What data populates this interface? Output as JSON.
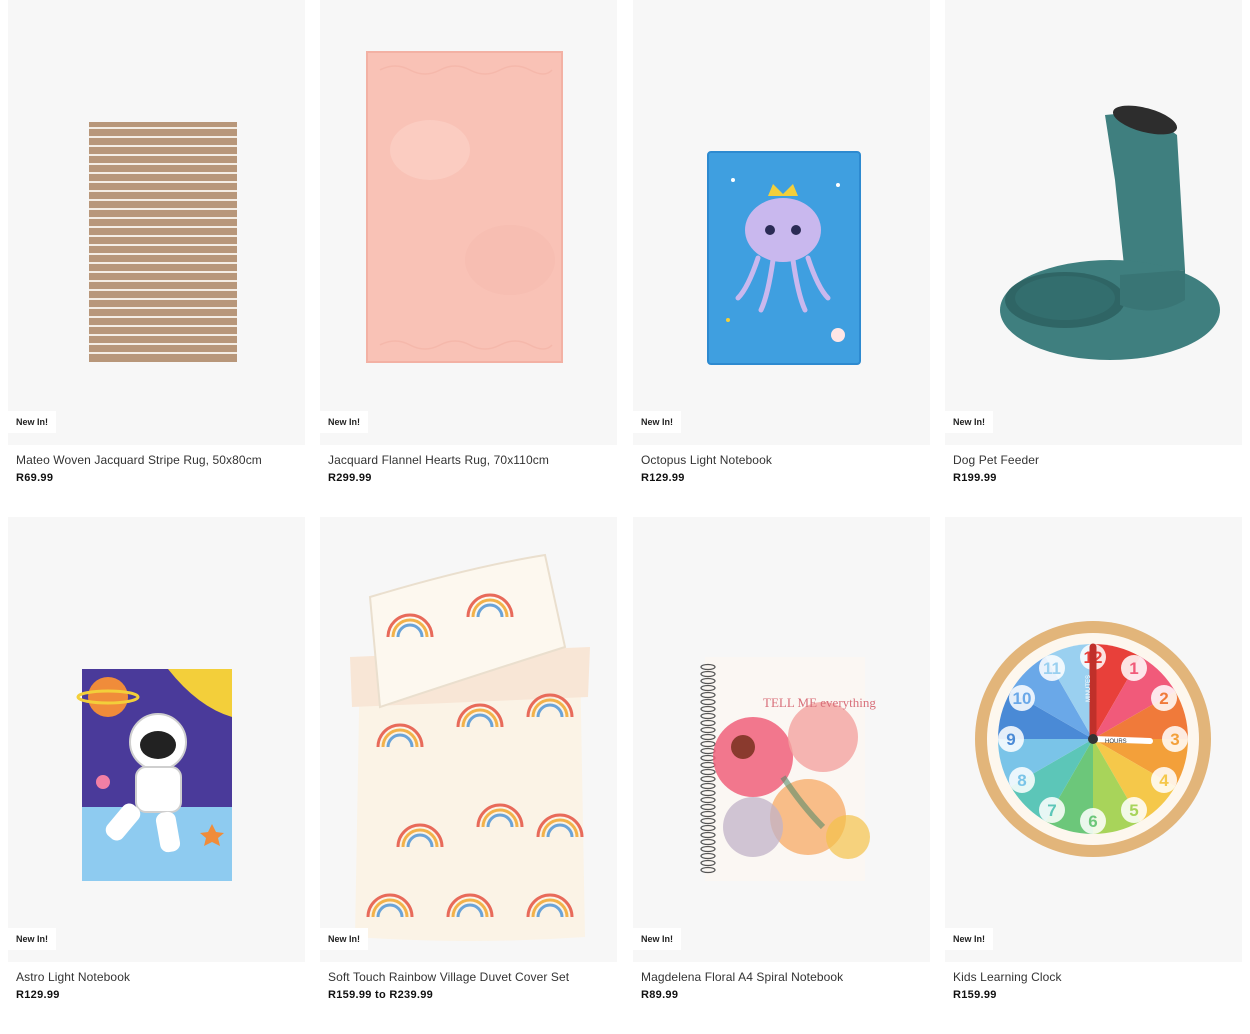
{
  "products": [
    {
      "badge": "New In!",
      "name": "Mateo Woven Jacquard Stripe Rug, 50x80cm",
      "price": "R69.99"
    },
    {
      "badge": "New In!",
      "name": "Jacquard Flannel Hearts Rug, 70x110cm",
      "price": "R299.99"
    },
    {
      "badge": "New In!",
      "name": "Octopus Light Notebook",
      "price": "R129.99"
    },
    {
      "badge": "New In!",
      "name": "Dog Pet Feeder",
      "price": "R199.99"
    },
    {
      "badge": "New In!",
      "name": "Astro Light Notebook",
      "price": "R129.99"
    },
    {
      "badge": "New In!",
      "name": "Soft Touch Rainbow Village Duvet Cover Set",
      "price": "R159.99 to R239.99"
    },
    {
      "badge": "New In!",
      "name": "Magdelena Floral A4 Spiral Notebook",
      "price": "R89.99"
    },
    {
      "badge": "New In!",
      "name": "Kids Learning Clock",
      "price": "R159.99"
    }
  ],
  "artwork": {
    "notebook_text": "TELL ME everything",
    "clock_numbers": [
      "12",
      "1",
      "2",
      "3",
      "4",
      "5",
      "6",
      "7",
      "8",
      "9",
      "10",
      "11"
    ],
    "clock_hand_labels": [
      "MINUTES",
      "HOURS"
    ]
  },
  "colors": {
    "card_bg": "#f7f7f7",
    "badge_bg": "#ffffff",
    "rug_stripe": "#b8977a",
    "rug_pink": "#f9c2b6",
    "notebook_blue": "#3f9fe0",
    "feeder_teal": "#3f7f7f",
    "clock_rim": "#e2b57a"
  }
}
